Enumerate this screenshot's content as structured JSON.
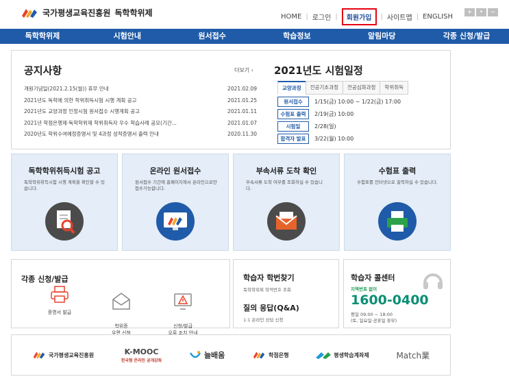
{
  "header": {
    "org_name": "국가평생교육진흥원",
    "site_name": "독학학위제",
    "util_links": [
      "HOME",
      "로그인",
      "회원가입",
      "사이트맵",
      "ENGLISH"
    ],
    "font_controls": [
      "+",
      "•",
      "−"
    ]
  },
  "nav": {
    "items": [
      "독학학위제",
      "시험안내",
      "원서접수",
      "학습정보",
      "알림마당",
      "각종 신청/발급"
    ]
  },
  "notice": {
    "title": "공지사항",
    "more": "더보기 ›",
    "items": [
      {
        "text": "개원기념일(2021.2.15(월)) 휴무 안내",
        "date": "2021.02.09"
      },
      {
        "text": "2021년도 독학에 의한 학위취득시험 시행 계획 공고",
        "date": "2021.01.25"
      },
      {
        "text": "2021년도 교양과정 인정시험 원서접수 시행계획 공고",
        "date": "2021.01.11"
      },
      {
        "text": "2021년 학점은행제·독학학위제 학위취득자 우수 학습사례 공모(기간...",
        "date": "2021.01.07"
      },
      {
        "text": "2020년도 학위수여예정증명서 및 4과정 성적증명서 출력 안내",
        "date": "2020.11.30"
      }
    ]
  },
  "schedule": {
    "title": "2021년도 시험일정",
    "tabs": [
      "교양과정",
      "전공기초과정",
      "전공심화과정",
      "학위취득"
    ],
    "rows": [
      {
        "label": "원서접수",
        "value": "1/15(금) 10:00 ~ 1/22(금) 17:00"
      },
      {
        "label": "수험표 출력",
        "value": "2/19(금) 10:00"
      },
      {
        "label": "시험일",
        "value": "2/28(일)"
      },
      {
        "label": "합격자 발표",
        "value": "3/22(월) 10:00"
      }
    ]
  },
  "cards": [
    {
      "title": "독학학위취득시험 공고",
      "desc": "독학학위취득시험 시행 계획을 확인할 수 있습니다.",
      "icon": "document-search-icon"
    },
    {
      "title": "온라인 원서접수",
      "desc": "원서접수 기간에 홈페이지에서 온라인으로만 접수가능합니다.",
      "icon": "monitor-logo-icon"
    },
    {
      "title": "부속서류 도착 확인",
      "desc": "부속서류 도착 여부를 조회하실 수 있습니다.",
      "icon": "envelope-icon"
    },
    {
      "title": "수험표 출력",
      "desc": "수험표를 인터넷으로 출력하실 수 있습니다.",
      "icon": "printer-icon"
    }
  ],
  "apply": {
    "title": "각종 신청/발급",
    "items": [
      {
        "label": "증명서 발급",
        "icon": "printer-icon"
      },
      {
        "label": "학위증\n우편 신청",
        "icon": "envelope-open-icon"
      },
      {
        "label": "신청/발급\n오류 조치 안내",
        "icon": "warning-monitor-icon"
      }
    ]
  },
  "find": {
    "title": "학습자 학번찾기",
    "desc": "독학학위제 학적번호 조회",
    "qa_title": "질의 응답(Q&A)",
    "qa_desc": "1:1 온라인 상담 신청"
  },
  "callcenter": {
    "title": "학습자 콜센터",
    "sub": "지역번호 없이",
    "number": "1600-0400",
    "hours": "평일 09:00 ~ 18:00\n(토, 일요일·공휴일 휴무)"
  },
  "partners": [
    {
      "name": "국가평생교육진흥원"
    },
    {
      "name": "K-MOOC",
      "sub": "한국형 온라인 공개강좌"
    },
    {
      "name": "늘배움"
    },
    {
      "name": "학점은행"
    },
    {
      "name": "평생학습계좌제"
    },
    {
      "name": "Match業"
    }
  ],
  "colors": {
    "primary": "#1f5ba8",
    "accent": "#e60012",
    "callcenter": "#0a8f74",
    "card_bg": "#e4edf8"
  }
}
